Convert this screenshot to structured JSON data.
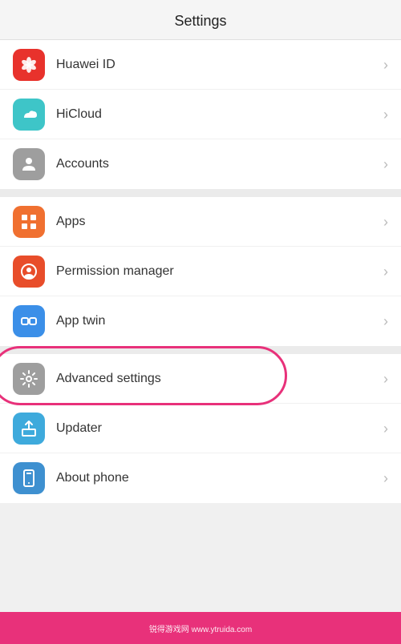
{
  "header": {
    "title": "Settings"
  },
  "groups": [
    {
      "id": "group1",
      "items": [
        {
          "id": "huawei-id",
          "label": "Huawei ID",
          "icon": "huawei",
          "iconColor": "#e8322c"
        },
        {
          "id": "hicloud",
          "label": "HiCloud",
          "icon": "hicloud",
          "iconColor": "#3ec5c8"
        },
        {
          "id": "accounts",
          "label": "Accounts",
          "icon": "accounts",
          "iconColor": "#9e9e9e"
        }
      ]
    },
    {
      "id": "group2",
      "items": [
        {
          "id": "apps",
          "label": "Apps",
          "icon": "apps",
          "iconColor": "#f07030"
        },
        {
          "id": "permission-manager",
          "label": "Permission manager",
          "icon": "permission",
          "iconColor": "#e84d2a"
        },
        {
          "id": "app-twin",
          "label": "App twin",
          "icon": "apptwin",
          "iconColor": "#3b8fe8"
        }
      ]
    },
    {
      "id": "group3",
      "items": [
        {
          "id": "advanced-settings",
          "label": "Advanced settings",
          "icon": "advanced",
          "iconColor": "#9e9e9e",
          "highlighted": true
        },
        {
          "id": "updater",
          "label": "Updater",
          "icon": "updater",
          "iconColor": "#3eaadc"
        },
        {
          "id": "about-phone",
          "label": "About phone",
          "icon": "aboutphone",
          "iconColor": "#3e90d0"
        }
      ]
    }
  ],
  "watermark": {
    "site": "锐得游戏网",
    "url": "www.ytruida.com"
  }
}
